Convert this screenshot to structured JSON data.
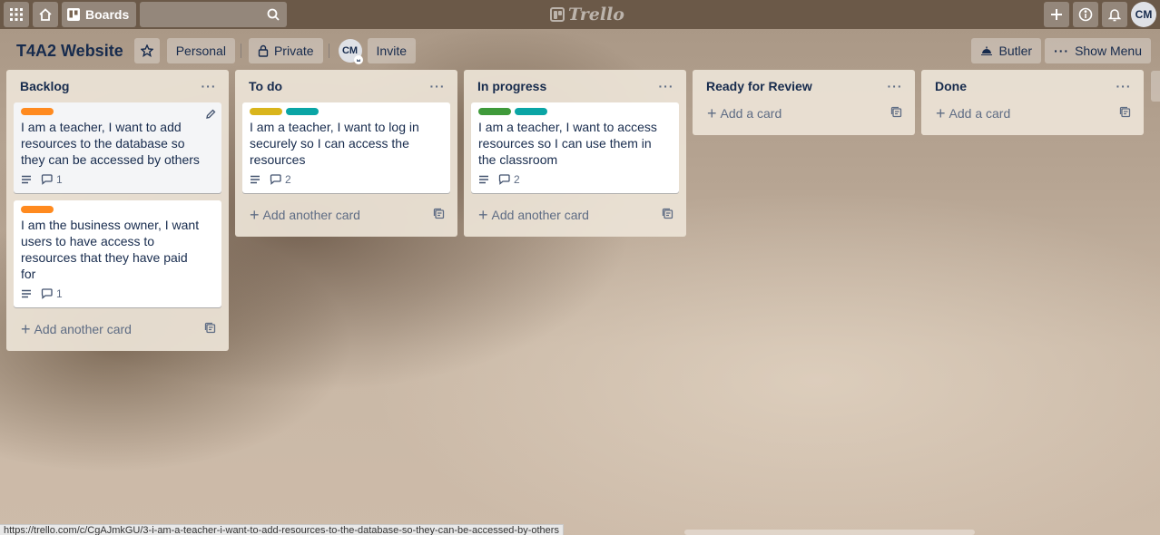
{
  "topbar": {
    "boards_label": "Boards",
    "logo_text": "Trello",
    "user_initials": "CM"
  },
  "board": {
    "title": "T4A2 Website",
    "visibility_team": "Personal",
    "visibility_privacy": "Private",
    "member_initials": "CM",
    "invite_label": "Invite",
    "butler_label": "Butler",
    "show_menu_label": "Show Menu"
  },
  "lists": [
    {
      "title": "Backlog",
      "add_label": "Add another card",
      "cards": [
        {
          "labels": [
            "#ff8a1f"
          ],
          "text": "I am a teacher, I want to add resources to the database so they can be accessed by others",
          "comments": "1"
        },
        {
          "labels": [
            "#ff8a1f"
          ],
          "text": "I am the business owner, I want users to have access to resources that they have paid for",
          "comments": "1"
        }
      ]
    },
    {
      "title": "To do",
      "add_label": "Add another card",
      "cards": [
        {
          "labels": [
            "#d9b51c",
            "#0aa5a5"
          ],
          "text": "I am a teacher, I want to log in securely so I can access the resources",
          "comments": "2"
        }
      ]
    },
    {
      "title": "In progress",
      "add_label": "Add another card",
      "cards": [
        {
          "labels": [
            "#3f9a3a",
            "#0aa5a5"
          ],
          "text": "I am a teacher, I want to access resources so I can use them in the classroom",
          "comments": "2"
        }
      ]
    },
    {
      "title": "Ready for Review",
      "add_label": "Add a card",
      "cards": []
    },
    {
      "title": "Done",
      "add_label": "Add a card",
      "cards": []
    }
  ],
  "status_url": "https://trello.com/c/CgAJmkGU/3-i-am-a-teacher-i-want-to-add-resources-to-the-database-so-they-can-be-accessed-by-others",
  "icons": {
    "apps": "apps-grid-icon",
    "home": "home-icon",
    "boards": "boards-icon",
    "search": "search-icon",
    "add": "plus-icon",
    "info": "info-icon",
    "notifications": "bell-icon",
    "star": "star-icon",
    "lock": "lock-icon",
    "butler": "butler-icon",
    "menu": "ellipsis-icon",
    "description": "description-icon",
    "comment": "comment-icon",
    "template": "card-template-icon",
    "edit": "pencil-icon"
  }
}
